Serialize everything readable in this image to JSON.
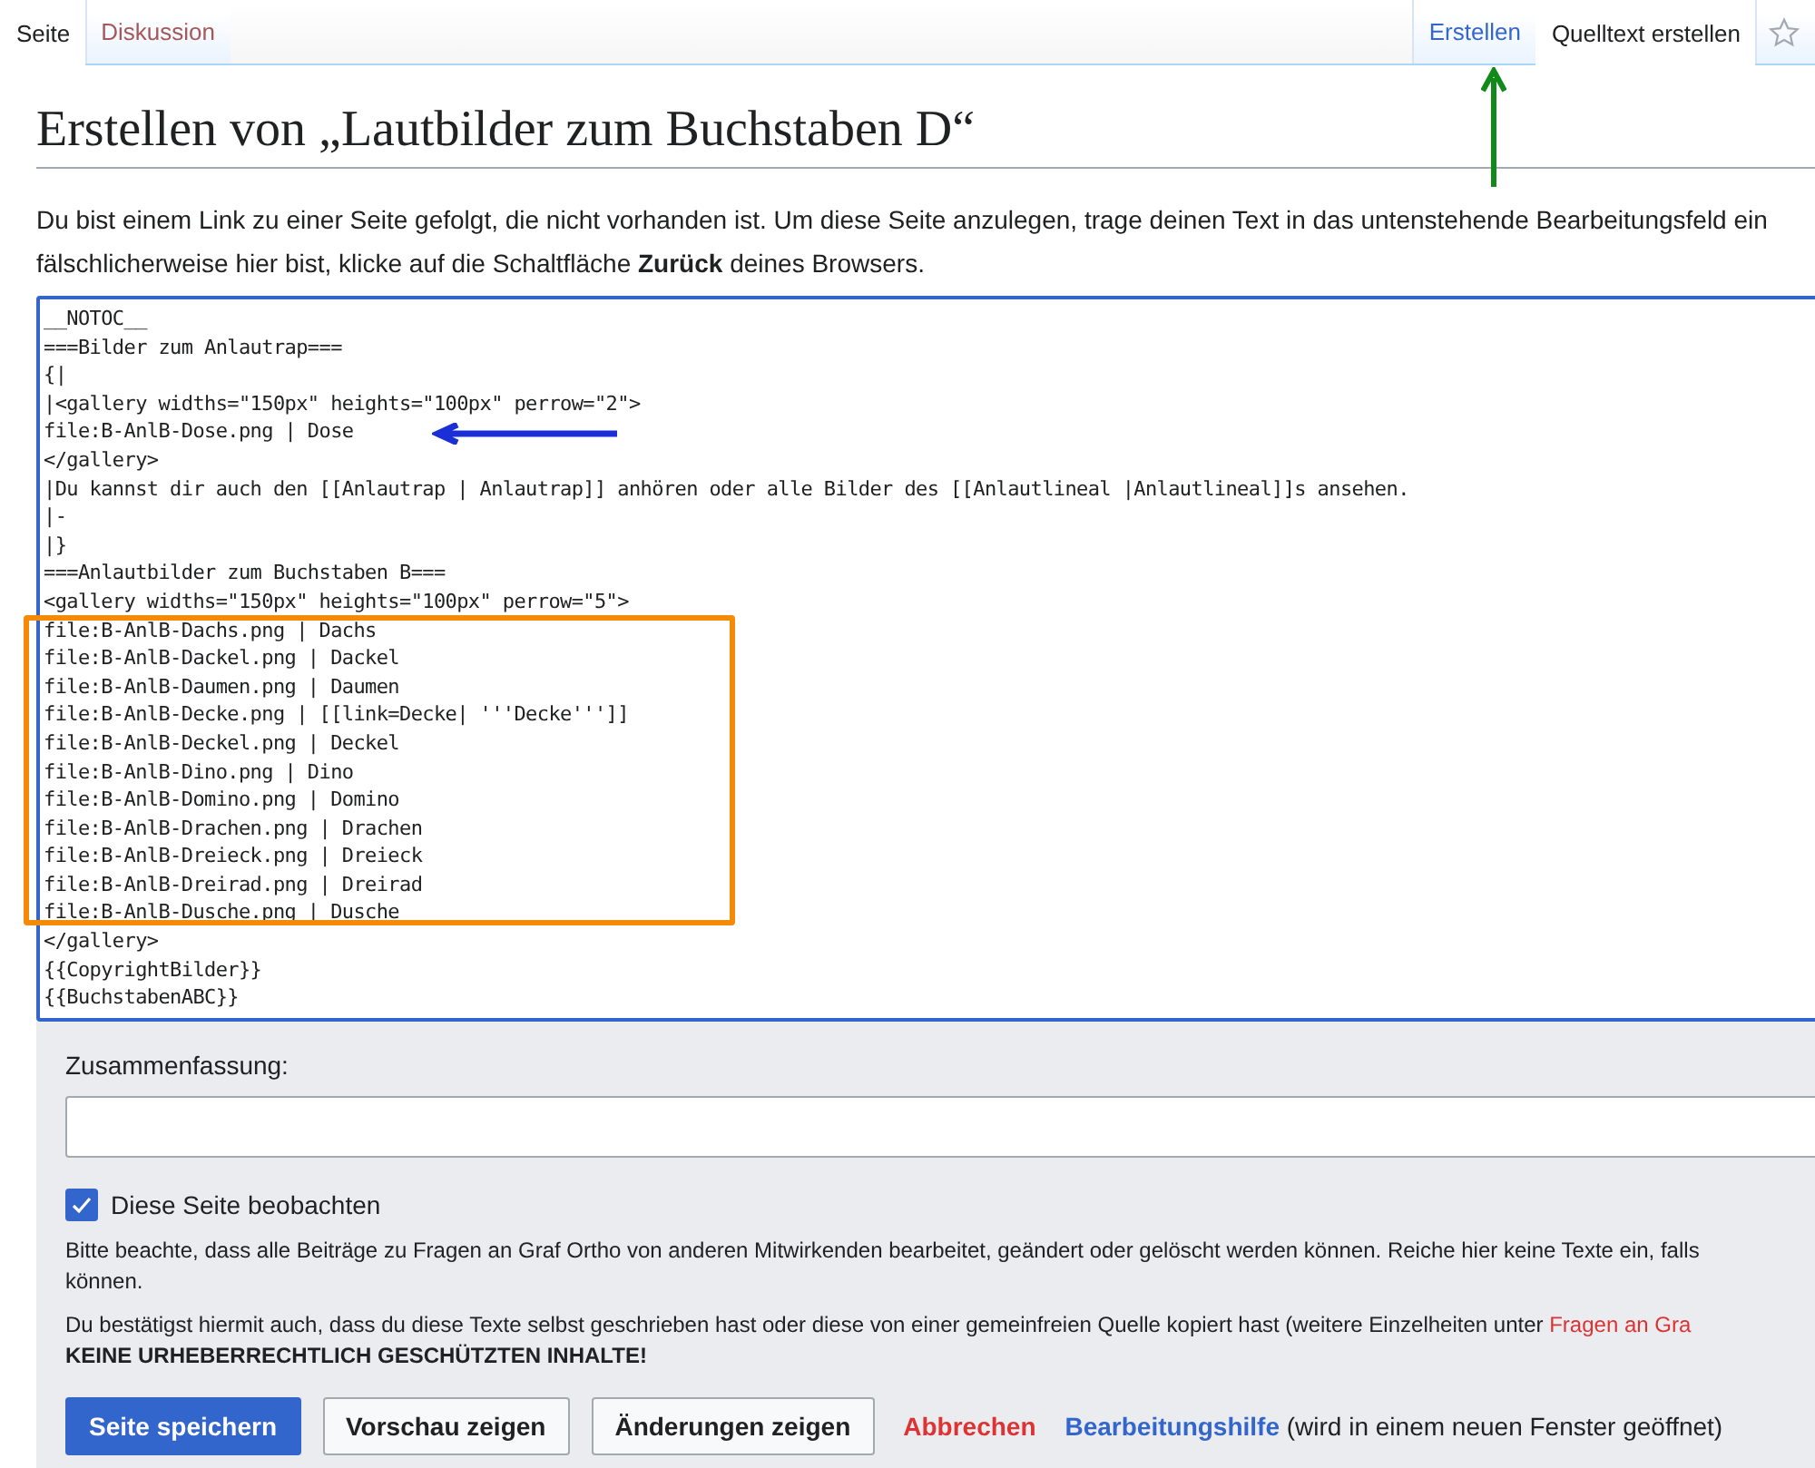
{
  "tabs_left": [
    {
      "label": "Seite",
      "selected": true
    },
    {
      "label": "Diskussion",
      "selected": false
    }
  ],
  "tabs_right": [
    {
      "label": "Erstellen",
      "selected": false
    },
    {
      "label": "Quelltext erstellen",
      "selected": true
    }
  ],
  "heading": "Erstellen von „Lautbilder zum Buchstaben D“",
  "intro_lines": [
    "Du bist einem Link zu einer Seite gefolgt, die nicht vorhanden ist. Um diese Seite anzulegen, trage deinen Text in das untenstehende Bearbeitungsfeld ein",
    "fälschlicherweise hier bist, klicke auf die Schaltfläche **Zurück** deines Browsers."
  ],
  "editor_lines": [
    "__NOTOC__",
    "===Bilder zum Anlautrap===",
    "{|",
    "|<gallery widths=\"150px\" heights=\"100px\" perrow=\"2\">",
    "file:B-AnlB-Dose.png | Dose",
    "</gallery>",
    "|Du kannst dir auch den [[Anlautrap | Anlautrap]] anhören oder alle Bilder des [[Anlautlineal |Anlautlineal]]s ansehen.",
    "|-",
    "|}",
    "===Anlautbilder zum Buchstaben B===",
    "<gallery widths=\"150px\" heights=\"100px\" perrow=\"5\">",
    "file:B-AnlB-Dachs.png | Dachs",
    "file:B-AnlB-Dackel.png | Dackel",
    "file:B-AnlB-Daumen.png | Daumen",
    "file:B-AnlB-Decke.png | [[link=Decke| '''Decke''']]",
    "file:B-AnlB-Deckel.png | Deckel",
    "file:B-AnlB-Dino.png | Dino",
    "file:B-AnlB-Domino.png | Domino",
    "file:B-AnlB-Drachen.png | Drachen",
    "file:B-AnlB-Dreieck.png | Dreieck",
    "file:B-AnlB-Dreirad.png | Dreirad",
    "file:B-AnlB-Dusche.png | Dusche",
    "</gallery>",
    "{{CopyrightBilder}}",
    "{{BuchstabenABC}}"
  ],
  "summary": {
    "label": "Zusammenfassung:"
  },
  "watch": {
    "label": "Diese Seite beobachten",
    "checked": true
  },
  "notice_lines": [
    "Bitte beachte, dass alle Beiträge zu Fragen an Graf Ortho von anderen Mitwirkenden bearbeitet, geändert oder gelöscht werden können. Reiche hier keine Texte ein, falls",
    "können."
  ],
  "license": {
    "text": "Du bestätigst hiermit auch, dass du diese Texte selbst geschrieben hast oder diese von einer gemeinfreien Quelle kopiert hast (weitere Einzelheiten unter",
    "link": "Fragen an Gra",
    "bold_line": "KEINE URHEBERRECHTLICH GESCHÜTZTEN INHALTE!"
  },
  "buttons": [
    {
      "label": "Seite speichern",
      "kind": "primary"
    },
    {
      "label": "Vorschau zeigen",
      "kind": "normal"
    },
    {
      "label": "Änderungen zeigen",
      "kind": "normal"
    },
    {
      "label": "Abbrechen",
      "kind": "cancel"
    }
  ],
  "help": {
    "link": "Bearbeitungshilfe",
    "note": "(wird in einem neuen Fenster geöffnet)"
  }
}
